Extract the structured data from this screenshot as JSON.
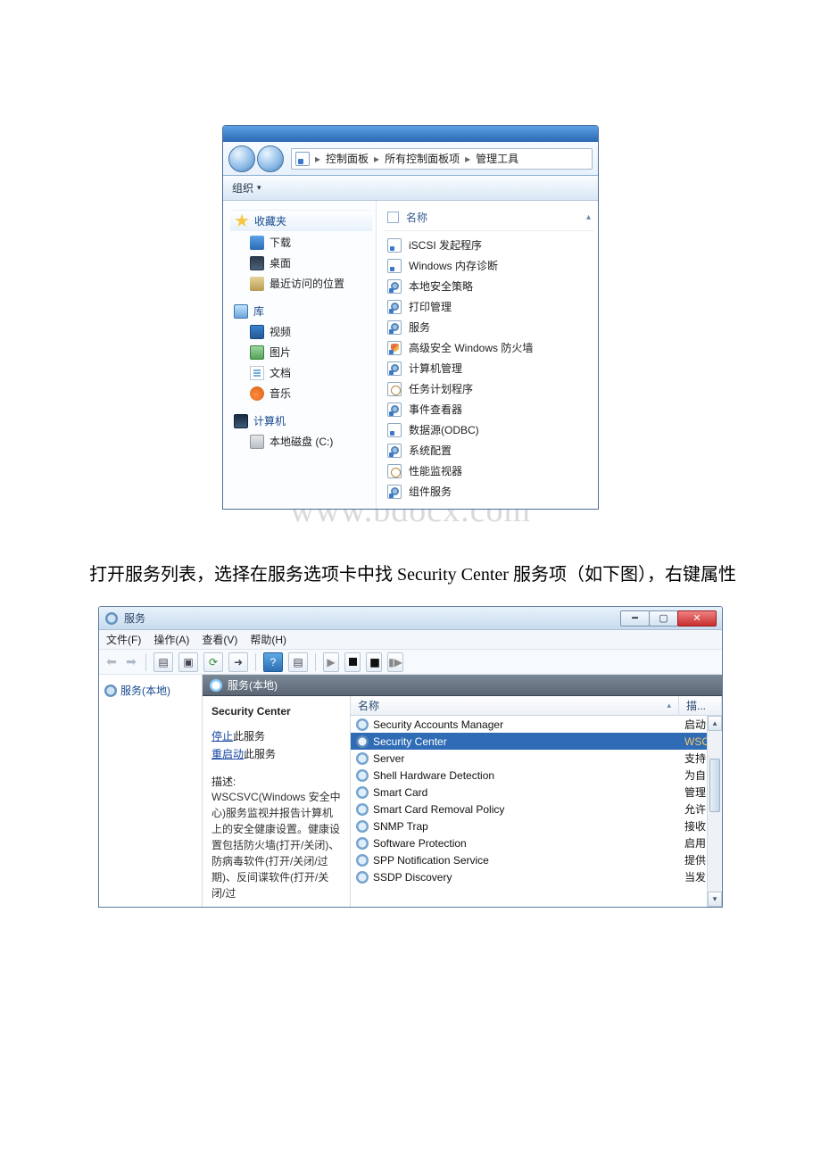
{
  "explorer": {
    "breadcrumb": [
      "控制面板",
      "所有控制面板项",
      "管理工具"
    ],
    "toolbar_label": "组织",
    "nav": {
      "favorites": {
        "label": "收藏夹",
        "items": [
          "下载",
          "桌面",
          "最近访问的位置"
        ]
      },
      "libraries": {
        "label": "库",
        "items": [
          "视频",
          "图片",
          "文档",
          "音乐"
        ]
      },
      "computer": {
        "label": "计算机",
        "items": [
          "本地磁盘 (C:)"
        ]
      }
    },
    "list_header": "名称",
    "items": [
      "iSCSI 发起程序",
      "Windows 内存诊断",
      "本地安全策略",
      "打印管理",
      "服务",
      "高级安全 Windows 防火墙",
      "计算机管理",
      "任务计划程序",
      "事件查看器",
      "数据源(ODBC)",
      "系统配置",
      "性能监视器",
      "组件服务"
    ]
  },
  "watermark": "www.bdocx.com",
  "article_text": "打开服务列表，选择在服务选项卡中找 Security Center 服务项（如下图），右键属性",
  "mmc": {
    "title": "服务",
    "menu": [
      "文件(F)",
      "操作(A)",
      "查看(V)",
      "帮助(H)"
    ],
    "tree_root": "服务(本地)",
    "right_header": "服务(本地)",
    "selected_service": "Security Center",
    "actions": {
      "stop_link": "停止",
      "stop_suffix": "此服务",
      "restart_link": "重启动",
      "restart_suffix": "此服务"
    },
    "desc_label": "描述:",
    "desc_text": "WSCSVC(Windows 安全中心)服务监视并报告计算机上的安全健康设置。健康设置包括防火墙(打开/关闭)、防病毒软件(打开/关闭/过期)、反间谍软件(打开/关闭/过",
    "columns": {
      "name": "名称",
      "desc": "描..."
    },
    "rows": [
      {
        "name": "Security Accounts Manager",
        "desc": "启动..."
      },
      {
        "name": "Security Center",
        "desc": "WSC..."
      },
      {
        "name": "Server",
        "desc": "支持..."
      },
      {
        "name": "Shell Hardware Detection",
        "desc": "为自..."
      },
      {
        "name": "Smart Card",
        "desc": "管理..."
      },
      {
        "name": "Smart Card Removal Policy",
        "desc": "允许..."
      },
      {
        "name": "SNMP Trap",
        "desc": "接收..."
      },
      {
        "name": "Software Protection",
        "desc": "启用 ..."
      },
      {
        "name": "SPP Notification Service",
        "desc": "提供..."
      },
      {
        "name": "SSDP Discovery",
        "desc": "当发..."
      }
    ],
    "selected_index": 1
  }
}
